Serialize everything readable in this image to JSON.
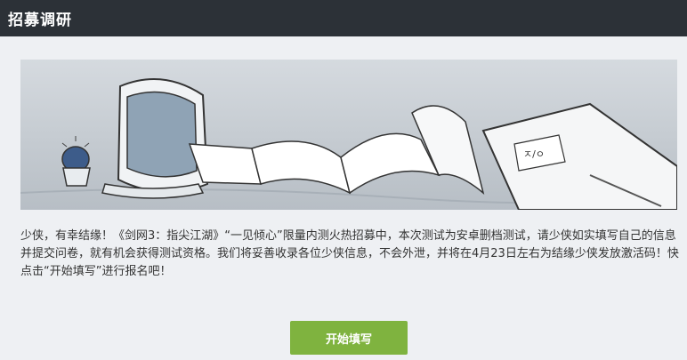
{
  "header": {
    "title": "招募调研"
  },
  "banner": {
    "note_text": "ㅈ/ㅇ"
  },
  "intro": {
    "text": "少侠，有幸结缘！《剑网3：指尖江湖》“一见倾心”限量内测火热招募中，本次测试为安卓删档测试，请少侠如实填写自己的信息并提交问卷，就有机会获得测试资格。我们将妥善收录各位少侠信息，不会外泄，并将在4月23日左右为结缘少侠发放激活码！快点击“开始填写”进行报名吧！"
  },
  "actions": {
    "start_label": "开始填写"
  },
  "colors": {
    "header_bg": "#2c3137",
    "page_bg": "#eef0f3",
    "button_bg": "#7fb33f"
  }
}
